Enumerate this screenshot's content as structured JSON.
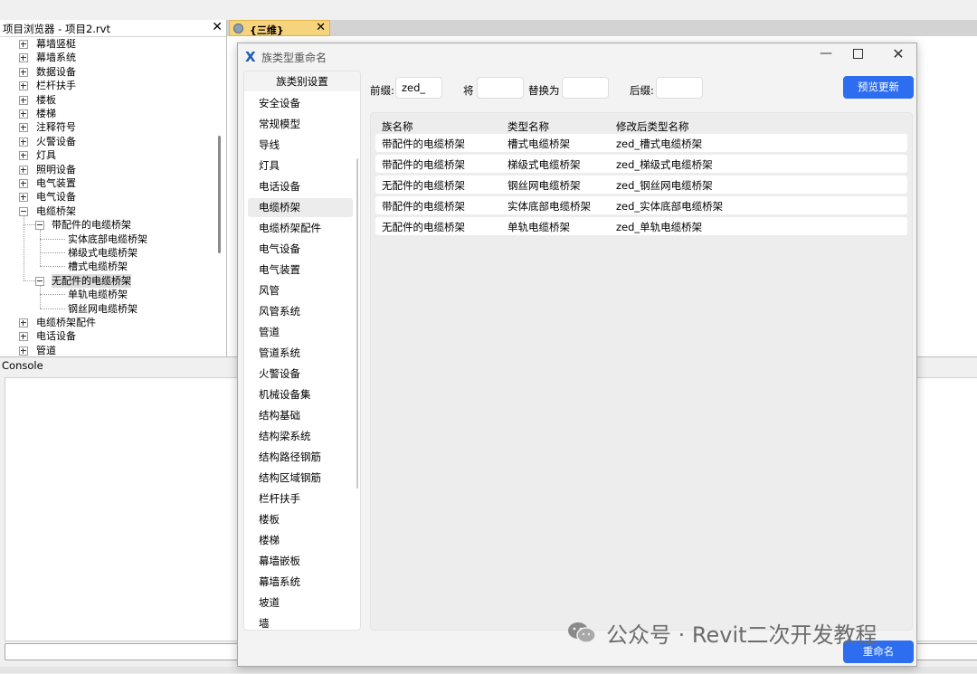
{
  "project_browser": {
    "title": "项目浏览器 - 项目2.rvt",
    "close": "✕",
    "items": [
      {
        "label": "幕墙竖梃",
        "level": 0,
        "expanded": false
      },
      {
        "label": "幕墙系统",
        "level": 0,
        "expanded": false
      },
      {
        "label": "数据设备",
        "level": 0,
        "expanded": false
      },
      {
        "label": "栏杆扶手",
        "level": 0,
        "expanded": false
      },
      {
        "label": "楼板",
        "level": 0,
        "expanded": false
      },
      {
        "label": "楼梯",
        "level": 0,
        "expanded": false
      },
      {
        "label": "注释符号",
        "level": 0,
        "expanded": false
      },
      {
        "label": "火警设备",
        "level": 0,
        "expanded": false
      },
      {
        "label": "灯具",
        "level": 0,
        "expanded": false
      },
      {
        "label": "照明设备",
        "level": 0,
        "expanded": false
      },
      {
        "label": "电气装置",
        "level": 0,
        "expanded": false
      },
      {
        "label": "电气设备",
        "level": 0,
        "expanded": false
      },
      {
        "label": "电缆桥架",
        "level": 0,
        "expanded": true
      },
      {
        "label": "带配件的电缆桥架",
        "level": 1,
        "expanded": true
      },
      {
        "label": "实体底部电缆桥架",
        "level": 2
      },
      {
        "label": "梯级式电缆桥架",
        "level": 2
      },
      {
        "label": "槽式电缆桥架",
        "level": 2
      },
      {
        "label": "无配件的电缆桥架",
        "level": 1,
        "expanded": true,
        "selected": true
      },
      {
        "label": "单轨电缆桥架",
        "level": 2
      },
      {
        "label": "钢丝网电缆桥架",
        "level": 2
      },
      {
        "label": "电缆桥架配件",
        "level": 0,
        "expanded": false
      },
      {
        "label": "电话设备",
        "level": 0,
        "expanded": false
      },
      {
        "label": "管道",
        "level": 0,
        "expanded": false
      }
    ]
  },
  "view_tab": {
    "label": "{三维}",
    "close": "✕"
  },
  "console": {
    "title": "Console"
  },
  "dialog": {
    "title": "族类型重命名",
    "logo": "X",
    "minimize": "—",
    "close": "✕",
    "category_header": "族类别设置",
    "selected_category": "电缆桥架",
    "categories": [
      "安全设备",
      "常规模型",
      "导线",
      "灯具",
      "电话设备",
      "电缆桥架",
      "电缆桥架配件",
      "电气设备",
      "电气装置",
      "风管",
      "风管系统",
      "管道",
      "管道系统",
      "火警设备",
      "机械设备集",
      "结构基础",
      "结构梁系统",
      "结构路径钢筋",
      "结构区域钢筋",
      "栏杆扶手",
      "楼板",
      "楼梯",
      "幕墙嵌板",
      "幕墙系统",
      "坡道",
      "墙"
    ],
    "prefix_label": "前缀:",
    "prefix_value": "zed_",
    "replace_label": "将",
    "replace_value": "",
    "replace_with_label": "替换为",
    "replace_with_value": "",
    "suffix_label": "后缀:",
    "suffix_value": "",
    "preview_button": "预览更新",
    "rename_button": "重命名",
    "columns": [
      "族名称",
      "类型名称",
      "修改后类型名称"
    ],
    "rows": [
      {
        "family": "带配件的电缆桥架",
        "type": "槽式电缆桥架",
        "new_type": "zed_槽式电缆桥架"
      },
      {
        "family": "带配件的电缆桥架",
        "type": "梯级式电缆桥架",
        "new_type": "zed_梯级式电缆桥架"
      },
      {
        "family": "无配件的电缆桥架",
        "type": "钢丝网电缆桥架",
        "new_type": "zed_钢丝网电缆桥架"
      },
      {
        "family": "带配件的电缆桥架",
        "type": "实体底部电缆桥架",
        "new_type": "zed_实体底部电缆桥架"
      },
      {
        "family": "无配件的电缆桥架",
        "type": "单轨电缆桥架",
        "new_type": "zed_单轨电缆桥架"
      }
    ]
  },
  "watermark": {
    "text": "公众号 · Revit二次开发教程"
  }
}
